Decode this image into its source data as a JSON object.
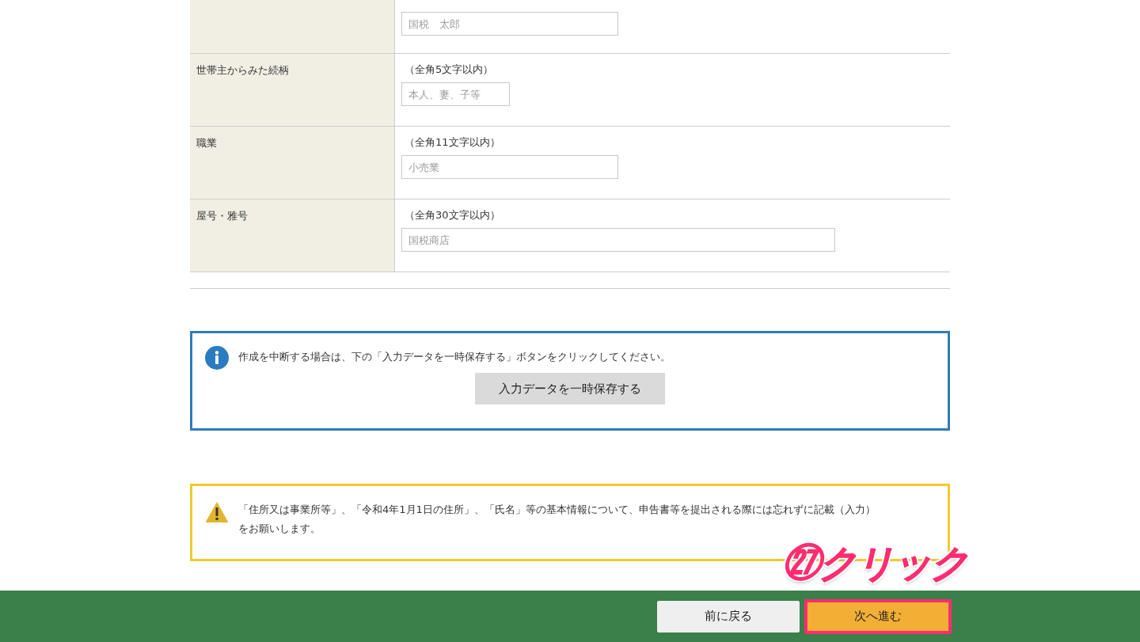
{
  "form_rows": [
    {
      "placeholder": "国税　太郎",
      "kind": "medium"
    },
    {
      "label": "世帯主からみた続柄",
      "hint": "（全角5文字以内）",
      "placeholder": "本人、妻、子等",
      "kind": "short"
    },
    {
      "label": "職業",
      "hint": "（全角11文字以内）",
      "placeholder": "小売業",
      "kind": "medium"
    },
    {
      "label": "屋号・雅号",
      "hint": "（全角30文字以内）",
      "placeholder": "国税商店",
      "kind": "long"
    }
  ],
  "info_box": {
    "message": "作成を中断する場合は、下の「入力データを一時保存する」ボタンをクリックしてください。",
    "button": "入力データを一時保存する"
  },
  "warning_box": {
    "message": "「住所又は事業所等」、「令和4年1月1日の住所」、「氏名」等の基本情報について、申告書等を提出される際には忘れずに記載（入力）をお願いします。"
  },
  "annotation": {
    "text": "㉗クリック"
  },
  "footer": {
    "buttons": [
      {
        "label": "前に戻る",
        "kind": "back",
        "highlighted": false
      },
      {
        "label": "次へ進む",
        "kind": "next",
        "highlighted": true
      }
    ]
  }
}
